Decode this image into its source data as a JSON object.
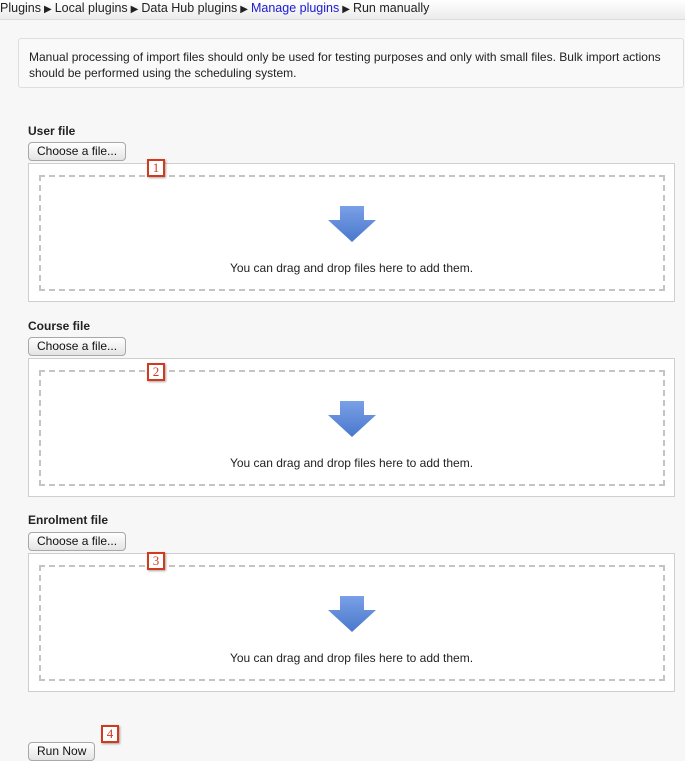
{
  "breadcrumb": {
    "items": [
      {
        "label": "Plugins",
        "link": false
      },
      {
        "label": "Local plugins",
        "link": false
      },
      {
        "label": "Data Hub plugins",
        "link": false
      },
      {
        "label": "Manage plugins",
        "link": true
      },
      {
        "label": "Run manually",
        "link": false
      }
    ],
    "separator": "▶"
  },
  "notice": {
    "text": "Manual processing of import files should only be used for testing purposes and only with small files. Bulk import actions should be performed using the scheduling system."
  },
  "sections": [
    {
      "label": "User file",
      "button": "Choose a file...",
      "drop_message": "You can drag and drop files here to add them.",
      "callout": "1"
    },
    {
      "label": "Course file",
      "button": "Choose a file...",
      "drop_message": "You can drag and drop files here to add them.",
      "callout": "2"
    },
    {
      "label": "Enrolment file",
      "button": "Choose a file...",
      "drop_message": "You can drag and drop files here to add them.",
      "callout": "3"
    }
  ],
  "run_button": {
    "label": "Run Now",
    "callout": "4"
  },
  "colors": {
    "link": "#1a1ad6",
    "arrow": "#5a86d6",
    "callout": "#d23a1e"
  }
}
